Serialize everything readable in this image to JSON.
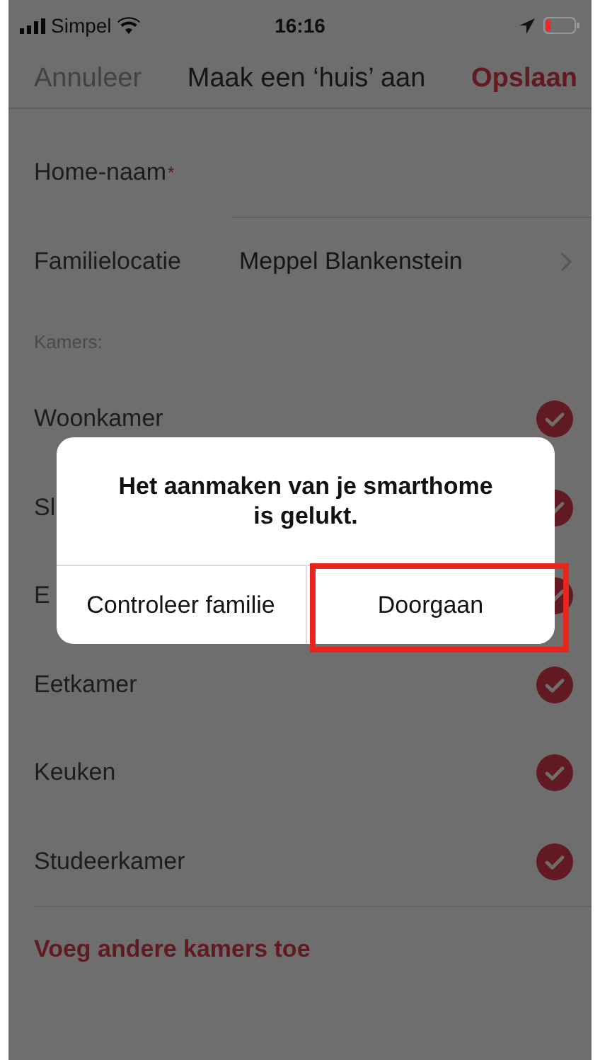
{
  "status_bar": {
    "carrier": "Simpel",
    "time": "16:16"
  },
  "nav_bar": {
    "cancel": "Annuleer",
    "title": "Maak een ‘huis’ aan",
    "save": "Opslaan"
  },
  "form": [
    {
      "kind": "text",
      "label": "Home-naam",
      "required": true,
      "required_mark": "*"
    },
    {
      "kind": "select",
      "label": "Familielocatie",
      "value": "Meppel Blankenstein",
      "required": false
    }
  ],
  "rooms_header": "Kamers:",
  "rooms": [
    {
      "name": "Woonkamer",
      "checked": true
    },
    {
      "name": "Sl",
      "checked": true
    },
    {
      "name": "E",
      "checked": true
    },
    {
      "name": "Eetkamer",
      "checked": true
    },
    {
      "name": "Keuken",
      "checked": true
    },
    {
      "name": "Studeerkamer",
      "checked": true
    }
  ],
  "add_rooms": "Voeg andere kamers toe",
  "dialog": {
    "message": "Het aanmaken van je smarthome is gelukt.",
    "buttons": [
      {
        "label": "Controleer familie",
        "highlighted": false
      },
      {
        "label": "Doorgaan",
        "highlighted": true
      }
    ]
  }
}
